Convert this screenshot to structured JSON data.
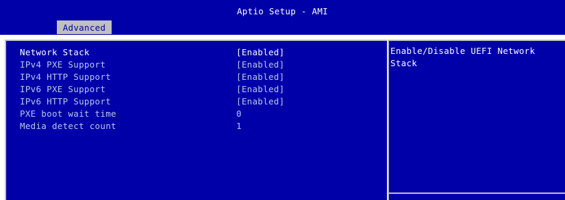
{
  "header": {
    "title": "Aptio Setup - AMI",
    "active_tab": "Advanced"
  },
  "settings": {
    "items": [
      {
        "label": "Network Stack",
        "value": "[Enabled]",
        "selected": true
      },
      {
        "label": "IPv4 PXE Support",
        "value": "[Enabled]",
        "selected": false
      },
      {
        "label": "IPv4 HTTP Support",
        "value": "[Enabled]",
        "selected": false
      },
      {
        "label": "IPv6 PXE Support",
        "value": "[Enabled]",
        "selected": false
      },
      {
        "label": "IPv6 HTTP Support",
        "value": "[Enabled]",
        "selected": false
      },
      {
        "label": "PXE boot wait time",
        "value": "0",
        "selected": false
      },
      {
        "label": "Media detect count",
        "value": "1",
        "selected": false
      }
    ]
  },
  "help": {
    "text": "Enable/Disable UEFI Network Stack"
  },
  "colors": {
    "background": "#0000a8",
    "tab_background": "#bfbfbf",
    "selected_text": "#ffffff",
    "normal_text": "#b8c8e8",
    "border": "#c0c0c0"
  }
}
